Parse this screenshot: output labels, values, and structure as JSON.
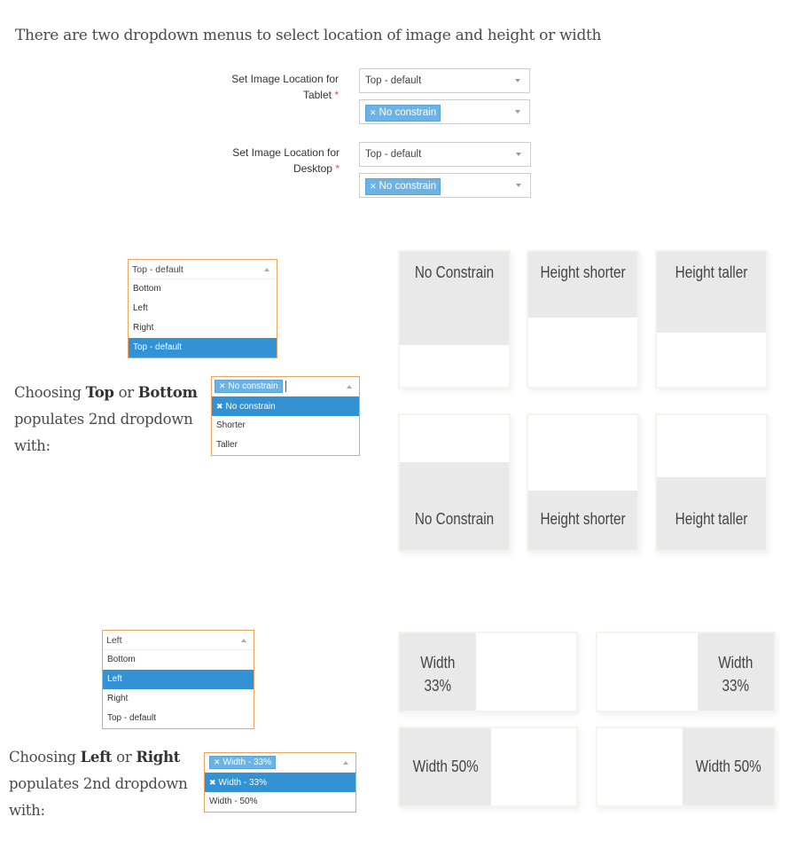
{
  "intro": "There are two dropdown menus to select location of image and height or width",
  "form": {
    "tablet": {
      "label_line1": "Set Image Location for",
      "label_line2": "Tablet",
      "required": "*",
      "location_value": "Top - default",
      "constraint_tag": "No constrain"
    },
    "desktop": {
      "label_line1": "Set Image Location for",
      "label_line2": "Desktop",
      "required": "*",
      "location_value": "Top - default",
      "constraint_tag": "No constrain"
    }
  },
  "section_top": {
    "location_dropdown": {
      "selected": "Top - default",
      "options": [
        "Bottom",
        "Left",
        "Right",
        "Top - default"
      ],
      "active_index": 3
    },
    "explanation": {
      "pre": "Choosing ",
      "b1": "Top",
      "mid": " or ",
      "b2": "Bottom",
      "post": " populates 2nd dropdown with:"
    },
    "constraint_dropdown": {
      "tag": "No constrain",
      "options": [
        "No constrain",
        "Shorter",
        "Taller"
      ],
      "active_index": 0
    },
    "cards_top": [
      {
        "label": "No Constrain",
        "fill_fraction": 0.69
      },
      {
        "label": "Height shorter",
        "fill_fraction": 0.49
      },
      {
        "label": "Height taller",
        "fill_fraction": 0.6
      }
    ],
    "cards_bottom": [
      {
        "label": "No Constrain",
        "fill_fraction": 0.65
      },
      {
        "label": "Height shorter",
        "fill_fraction": 0.44
      },
      {
        "label": "Height taller",
        "fill_fraction": 0.54
      }
    ]
  },
  "section_side": {
    "location_dropdown": {
      "selected": "Left",
      "options": [
        "Bottom",
        "Left",
        "Right",
        "Top - default"
      ],
      "active_index": 1
    },
    "explanation": {
      "pre": "Choosing ",
      "b1": "Left",
      "mid": " or ",
      "b2": "Right",
      "post": " populates 2nd dropdown with:"
    },
    "constraint_dropdown": {
      "tag": "Width - 33%",
      "options": [
        "Width - 33%",
        "Width - 50%"
      ],
      "active_index": 0
    },
    "cards": [
      {
        "label_line1": "Width",
        "label_line2": "33%",
        "side": "left",
        "width_fraction": 0.33
      },
      {
        "label_line1": "Width",
        "label_line2": "33%",
        "side": "right",
        "width_fraction": 0.33
      },
      {
        "label": "Width 50%",
        "side": "left",
        "width_fraction": 0.5
      },
      {
        "label": "Width 50%",
        "side": "right",
        "width_fraction": 0.5
      }
    ]
  },
  "colors": {
    "accent": "#3392d3",
    "tag": "#6bb3e6",
    "focus_border": "#f0a35e",
    "card_fill": "#e9e9e9",
    "required": "#d9534f"
  }
}
